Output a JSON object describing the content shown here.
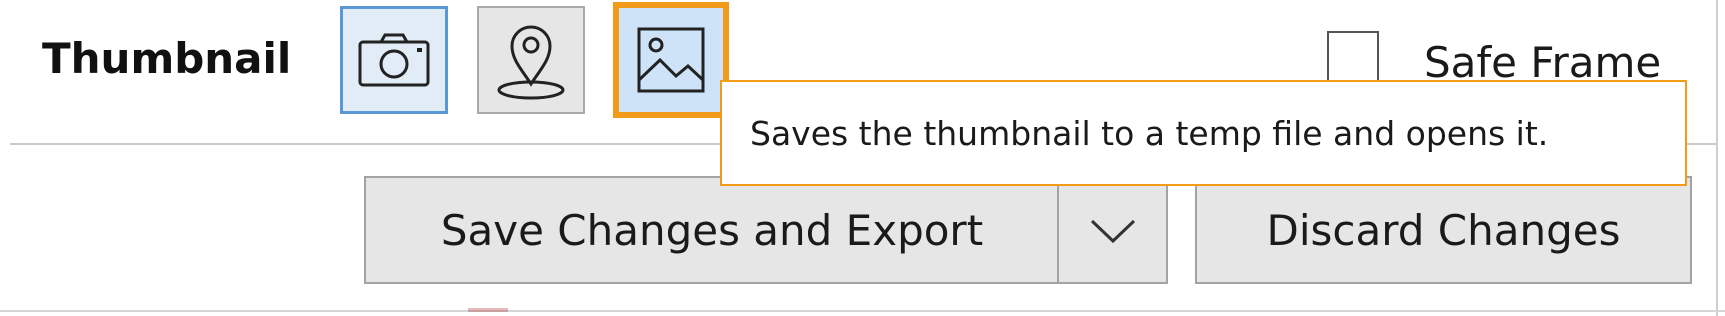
{
  "thumbnail": {
    "label": "Thumbnail",
    "buttons": [
      {
        "icon": "camera-icon",
        "state": "selected"
      },
      {
        "icon": "location-pin-icon",
        "state": "normal"
      },
      {
        "icon": "image-icon",
        "state": "focused-hover"
      }
    ]
  },
  "safe_frame": {
    "label": "Safe Frame",
    "checked": false
  },
  "tooltip": {
    "text": "Saves the thumbnail to a temp file and opens it."
  },
  "actions": {
    "save_export_label": "Save Changes and Export",
    "dropdown_icon": "chevron-down-icon",
    "discard_label": "Discard Changes"
  },
  "colors": {
    "focus_orange": "#f29a19",
    "selected_blue_border": "#5a97d6",
    "selected_blue_fill": "#cfe3f8",
    "button_fill": "#e6e6e6"
  }
}
